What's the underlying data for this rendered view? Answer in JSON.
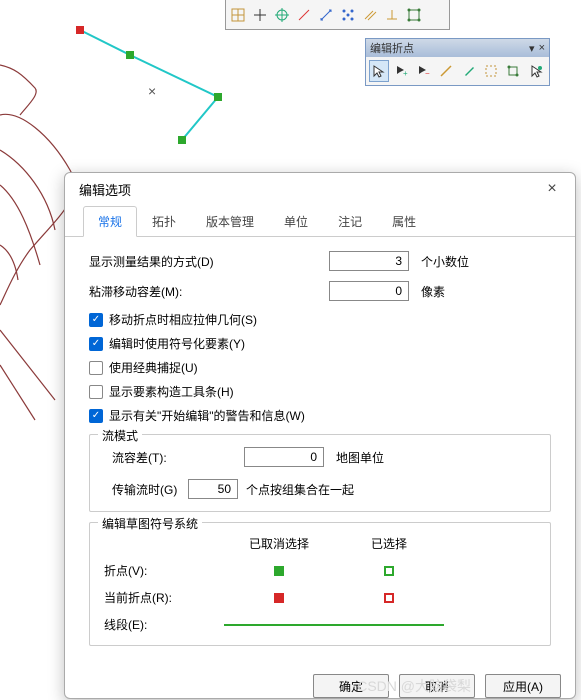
{
  "float_toolbar": {
    "title": "编辑折点",
    "icons": [
      "pointer-icon",
      "add-vertex-icon",
      "delete-vertex-icon",
      "sketch-line-icon",
      "sketch-pen-icon",
      "select-box-icon",
      "topology-icon",
      "finish-icon"
    ]
  },
  "top_toolbar": {
    "icons": [
      "grid-icon",
      "crosshair-icon",
      "diag-icon",
      "target-icon",
      "scale-icon",
      "snap-icon",
      "snap2-icon",
      "scatter-icon",
      "parallel-icon",
      "perp-icon",
      "topo-icon"
    ]
  },
  "dialog": {
    "title": "编辑选项",
    "close": "×",
    "tabs": [
      "常规",
      "拓扑",
      "版本管理",
      "单位",
      "注记",
      "属性"
    ],
    "active_tab": 0,
    "labels": {
      "display_result": "显示测量结果的方式(D)",
      "sticky_move": "粘滞移动容差(M):",
      "decimal_unit": "个小数位",
      "pixel_unit": "像素",
      "stretch_geom": "移动折点时相应拉伸几何(S)",
      "use_symbology": "编辑时使用符号化要素(Y)",
      "use_classic": "使用经典捕捉(U)",
      "show_construct": "显示要素构造工具条(H)",
      "show_warnings": "显示有关\"开始编辑\"的警告和信息(W)",
      "stream_group": "流模式",
      "stream_tol": "流容差(T):",
      "map_unit": "地图单位",
      "transfer_stream": "传输流时(G)",
      "group_together": "个点按组集合在一起",
      "sketch_group": "编辑草图符号系统",
      "deselected": "已取消选择",
      "selected": "已选择",
      "vertex": "折点(V):",
      "current_vertex": "当前折点(R):",
      "segment": "线段(E):"
    },
    "values": {
      "decimal_places": "3",
      "sticky_tolerance": "0",
      "stream_tolerance": "0",
      "transfer_count": "50"
    },
    "checks": {
      "stretch_geom": true,
      "use_symbology": true,
      "use_classic": false,
      "show_construct": false,
      "show_warnings": true
    },
    "buttons": {
      "ok": "确定",
      "cancel": "取消",
      "apply": "应用(A)"
    }
  },
  "watermark": "CSDN @大脑袋梨"
}
